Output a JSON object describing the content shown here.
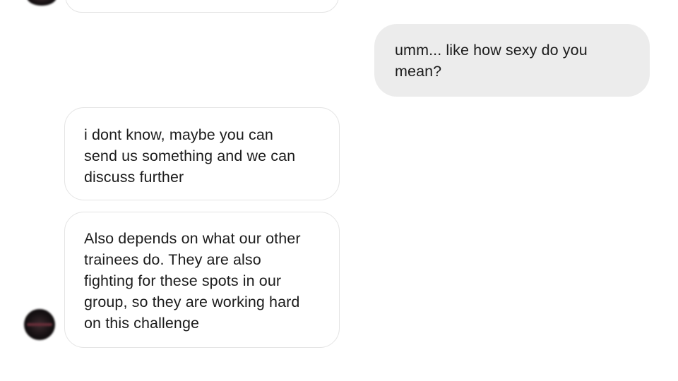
{
  "conversation": {
    "messages": [
      {
        "direction": "incoming",
        "partial": true,
        "lines": []
      },
      {
        "direction": "outgoing",
        "lines": [
          "umm... like how sexy do you",
          "mean?"
        ]
      },
      {
        "direction": "incoming",
        "lines": [
          "i dont know, maybe you can",
          "send us something and we can",
          "discuss further"
        ]
      },
      {
        "direction": "incoming",
        "lines": [
          "Also depends on what our other",
          "trainees do. They are also",
          "fighting for these spots in our",
          "group, so they are working hard",
          "on this challenge"
        ]
      }
    ],
    "avatars": [
      {
        "name": "contact-avatar",
        "icon": "avatar-blurred"
      }
    ],
    "colors": {
      "outgoing_bubble": "#ececec",
      "incoming_bubble": "#ffffff",
      "incoming_border": "#e4e4e4",
      "text": "#1c1c1c"
    }
  }
}
